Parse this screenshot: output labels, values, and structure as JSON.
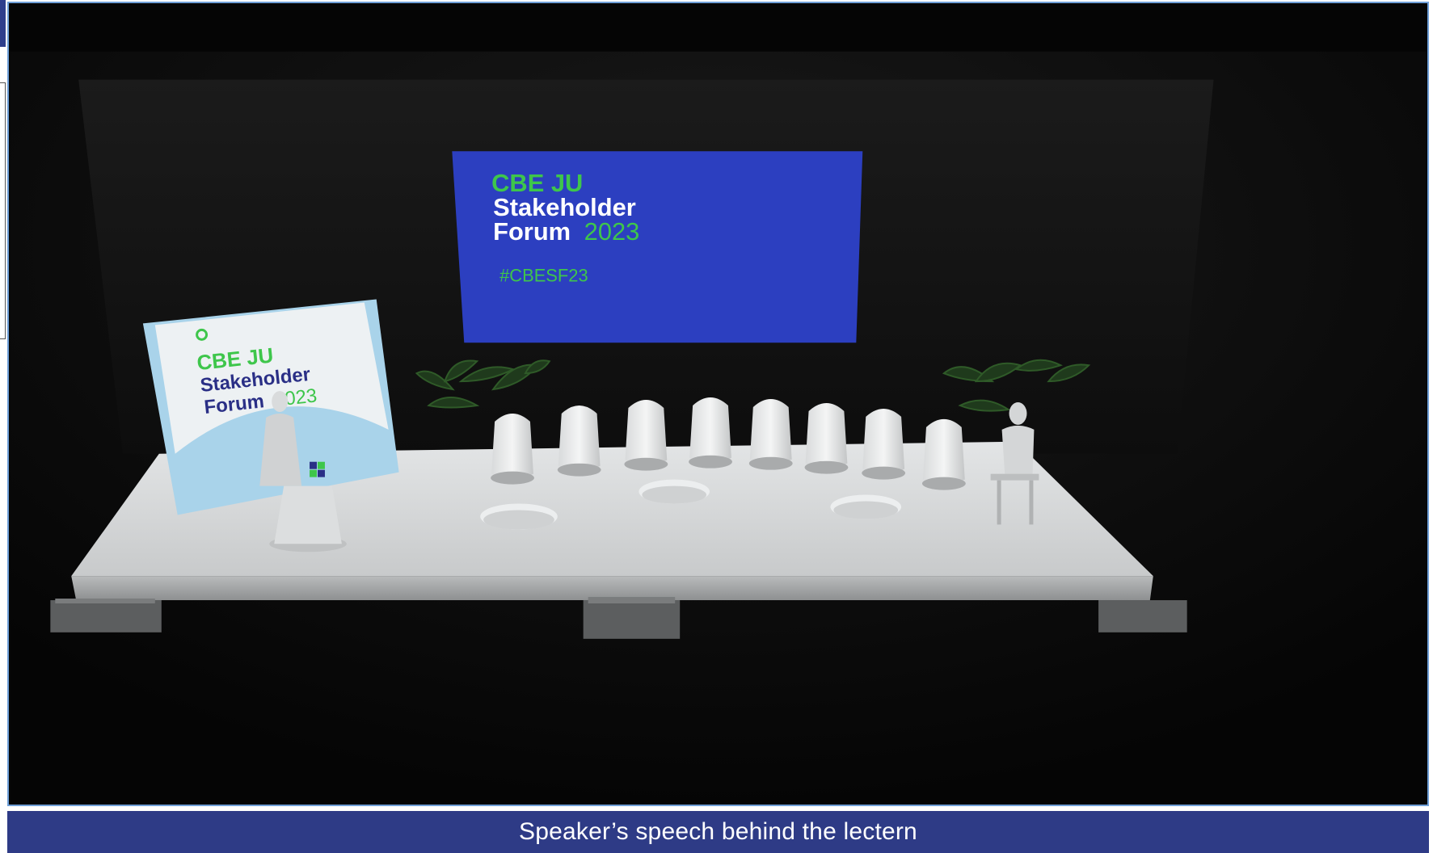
{
  "colors": {
    "caption_bar": "#2e3b86",
    "frame_border": "#6f9fd8",
    "screen_blue": "#2c3fc0",
    "brand_green": "#3ec64b",
    "brand_navy": "#2a2f86",
    "backdrop_light_blue": "#a9d3ea"
  },
  "screen": {
    "line1": "CBE JU",
    "line2": "Stakeholder",
    "line3_word": "Forum",
    "line3_year": "2023",
    "hashtag": "#CBESF23"
  },
  "backdrop": {
    "line1": "CBE JU",
    "line2": "Stakeholder",
    "line3_word": "Forum",
    "line3_year": "2023"
  },
  "caption": "Speaker’s speech behind the lectern"
}
